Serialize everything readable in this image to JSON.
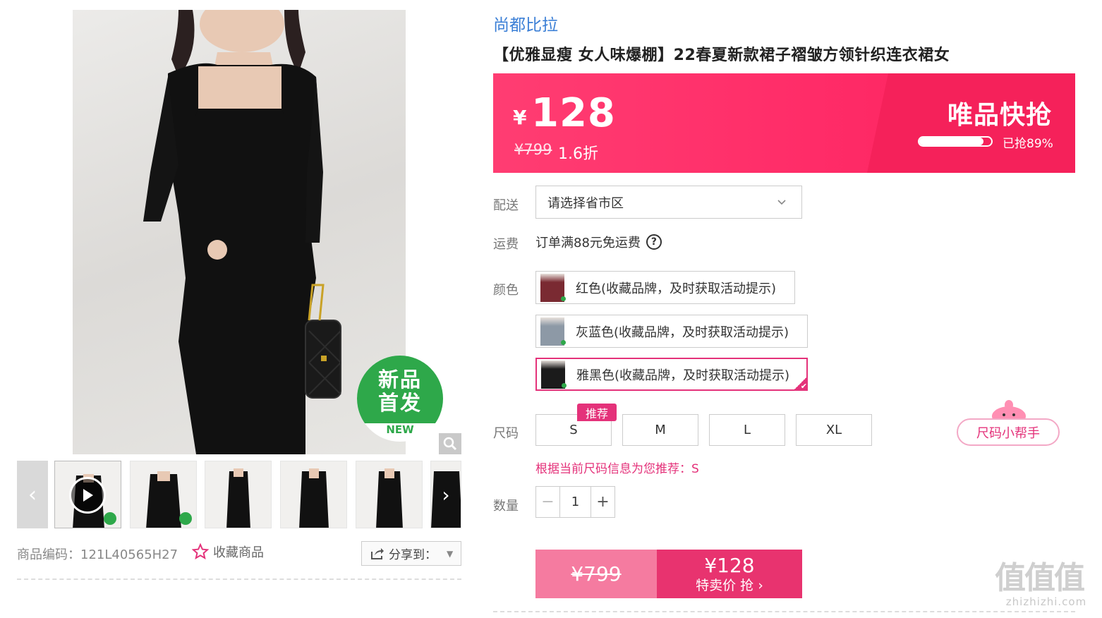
{
  "brand": "尚都比拉",
  "title": "【优雅显瘦 女人味爆棚】22春夏新款裙子褶皱方领针织连衣裙女",
  "badge": {
    "line1": "新品",
    "line2": "首发",
    "en": "NEW"
  },
  "price": {
    "currency": "¥",
    "value": "128",
    "original": "¥799",
    "discount": "1.6折",
    "flash_label": "唯品快抢",
    "progress_text": "已抢89%",
    "progress_fraction": 0.89
  },
  "gallery": {
    "thumb_count": 6,
    "active_index": 0
  },
  "product_code": "商品编码：121L40565H27",
  "favorite_label": "收藏商品",
  "share_label": "分享到：",
  "labels": {
    "delivery": "配送",
    "shipping": "运费",
    "color": "颜色",
    "size": "尺码",
    "quantity": "数量"
  },
  "region": {
    "placeholder": "请选择省市区"
  },
  "shipping_text": "订单满88元免运费",
  "colors": [
    {
      "label": "红色(收藏品牌，及时获取活动提示)",
      "swatch": "#7a2a32",
      "selected": false
    },
    {
      "label": "灰蓝色(收藏品牌，及时获取活动提示)",
      "swatch": "#8d99a6",
      "selected": false
    },
    {
      "label": "雅黑色(收藏品牌，及时获取活动提示)",
      "swatch": "#1b1b1b",
      "selected": true
    }
  ],
  "sizes": [
    "S",
    "M",
    "L",
    "XL"
  ],
  "size_tag": "推荐",
  "size_helper": "尺码小帮手",
  "size_recommend": "根据当前尺码信息为您推荐：S",
  "quantity": {
    "minus": "−",
    "value": "1",
    "plus": "+"
  },
  "buy": {
    "original": "¥799",
    "price": "¥128",
    "sub": "特卖价 抢"
  },
  "watermark": {
    "big": "值值值",
    "small": "zhizhizhi.com"
  },
  "colors_theme": {
    "accent": "#e4327a",
    "price_bar": "#ff2c68",
    "brand_link": "#3b7fd6",
    "new_green": "#2ea84a"
  }
}
